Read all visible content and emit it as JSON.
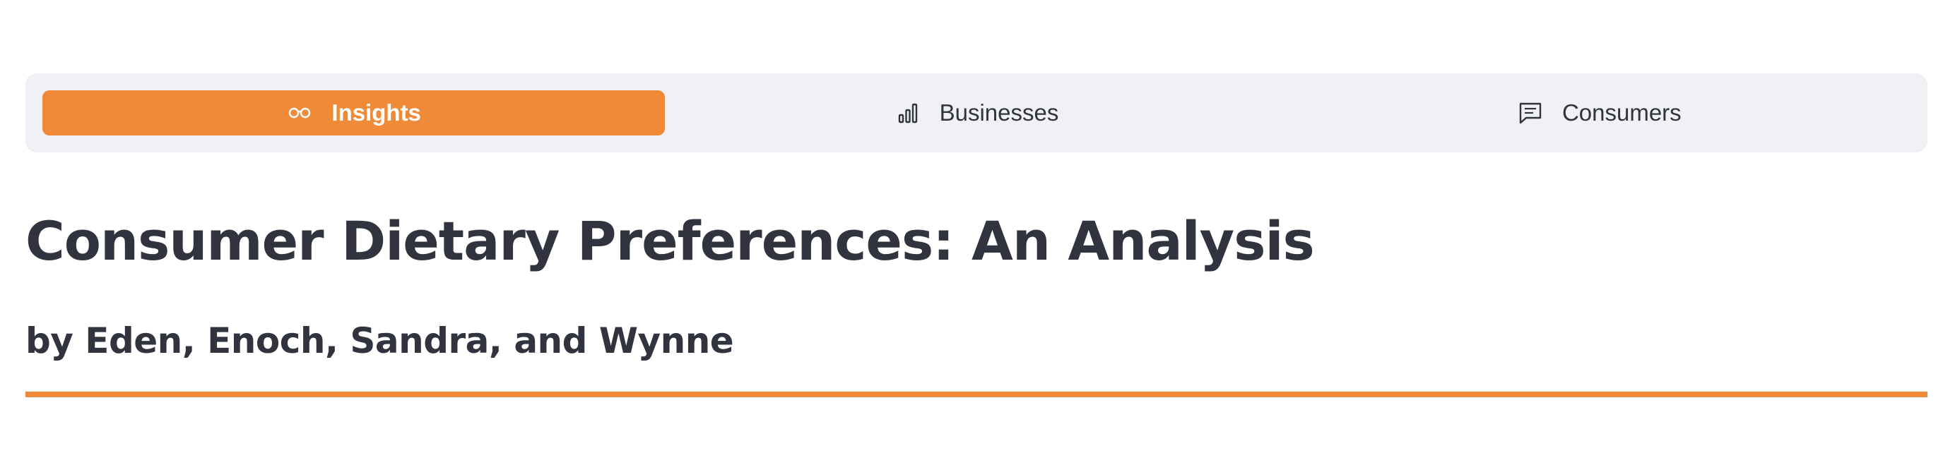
{
  "tabs": [
    {
      "label": "Insights",
      "icon": "glasses-icon",
      "active": true
    },
    {
      "label": "Businesses",
      "icon": "bar-chart-icon",
      "active": false
    },
    {
      "label": "Consumers",
      "icon": "message-icon",
      "active": false
    }
  ],
  "page": {
    "title": "Consumer Dietary Preferences: An Analysis",
    "subtitle": "by Eden, Enoch, Sandra, and Wynne"
  },
  "colors": {
    "accent": "#ef8a39",
    "tabbar_background": "#f0f1f5",
    "text": "#31333f"
  }
}
